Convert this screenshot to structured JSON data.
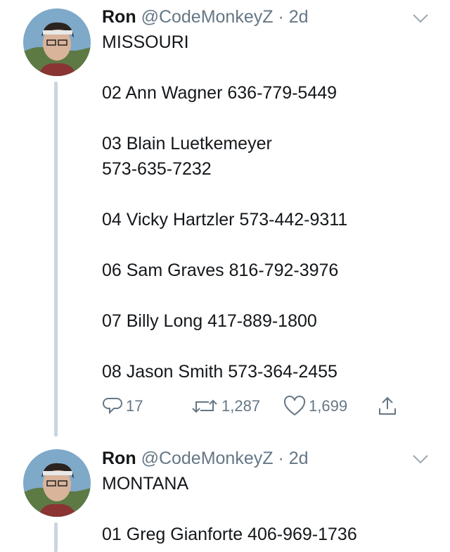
{
  "tweets": [
    {
      "name": "Ron",
      "handle": "@CodeMonkeyZ",
      "separator": "·",
      "time": "2d",
      "lines": [
        "MISSOURI",
        "02 Ann Wagner 636-779-5449",
        "03 Blain Luetkemeyer",
        "573-635-7232",
        "04 Vicky Hartzler 573-442-9311",
        "06 Sam Graves 816-792-3976",
        "07 Billy Long 417-889-1800",
        "08 Jason Smith 573-364-2455"
      ],
      "actions": {
        "replies": "17",
        "retweets": "1,287",
        "likes": "1,699"
      }
    },
    {
      "name": "Ron",
      "handle": "@CodeMonkeyZ",
      "separator": "·",
      "time": "2d",
      "lines": [
        "MONTANA",
        "01 Greg Gianforte 406-969-1736"
      ]
    }
  ],
  "icons": {
    "reply": "reply-icon",
    "retweet": "retweet-icon",
    "like": "heart-icon",
    "share": "share-icon",
    "caret": "chevron-down-icon"
  },
  "colors": {
    "text": "#14171a",
    "muted": "#657786",
    "thread_line": "#c9d6df"
  }
}
